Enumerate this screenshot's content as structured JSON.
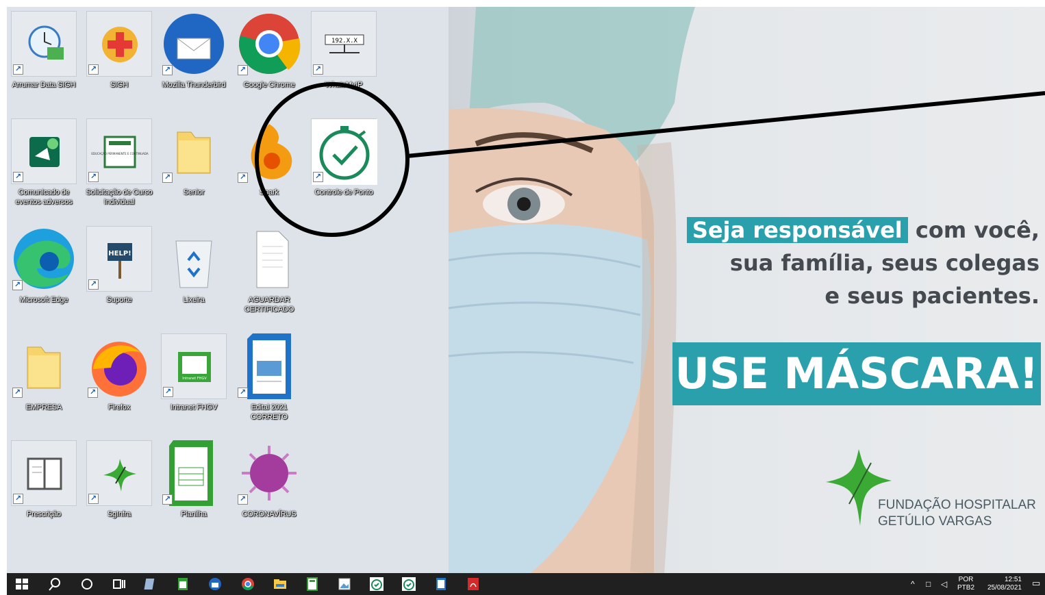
{
  "desktop_icons": [
    {
      "label": "Arrumar Data SIGH",
      "icon": "clock-calendar-icon"
    },
    {
      "label": "SIGH",
      "icon": "medical-cross-icon"
    },
    {
      "label": "Mozilla Thunderbird",
      "icon": "thunderbird-icon"
    },
    {
      "label": "Google Chrome",
      "icon": "chrome-icon"
    },
    {
      "label": "WhatsMyIP",
      "icon": "network-ip-icon",
      "badge": "192.X.X"
    },
    {
      "label": "Comunicado de eventos adversos",
      "icon": "megaphone-icon"
    },
    {
      "label": "Solicitação de Curso Individual",
      "icon": "education-certificate-icon",
      "badge": "EDUCAÇÃO PERMANENTE E CONTINUADA"
    },
    {
      "label": "Senior",
      "icon": "folder-icon"
    },
    {
      "label": "Spark",
      "icon": "spark-flame-icon"
    },
    {
      "label": "Controle de Ponto",
      "icon": "stopwatch-check-icon"
    },
    {
      "label": "Microsoft Edge",
      "icon": "edge-icon"
    },
    {
      "label": "Suporte",
      "icon": "help-sign-icon",
      "badge": "HELP!"
    },
    {
      "label": "Lixeira",
      "icon": "recycle-bin-icon"
    },
    {
      "label": "AGUARDAR CERTIFICADO",
      "icon": "document-icon"
    },
    {
      "label": "EMPRESA",
      "icon": "folder-icon"
    },
    {
      "label": "Firefox",
      "icon": "firefox-icon"
    },
    {
      "label": "Intranet FHGV",
      "icon": "intranet-icon",
      "badge": "Intranet FHGV"
    },
    {
      "label": "Edital 2021 CORRETO",
      "icon": "writer-document-icon"
    },
    {
      "label": "Prescrição",
      "icon": "book-icon"
    },
    {
      "label": "SgInfra",
      "icon": "fhgv-cross-icon"
    },
    {
      "label": "Planilha",
      "icon": "calc-spreadsheet-icon"
    },
    {
      "label": "CORONAVÍRUS",
      "icon": "virus-icon"
    }
  ],
  "wallpaper": {
    "line1_highlight": "Seja responsável",
    "line1_rest": "com você,",
    "line2": "sua família, seus colegas",
    "line3": "e seus pacientes.",
    "banner": "USE MÁSCARA!",
    "org_line1": "FUNDAÇÃO HOSPITALAR",
    "org_line2": "GETÚLIO VARGAS",
    "accent_color": "#2aa0ad",
    "brand_green": "#3aaa35"
  },
  "taskbar": {
    "items": [
      "start-icon",
      "search-icon",
      "cortana-icon",
      "task-view-icon",
      "libreoffice-icon",
      "spreadsheet-icon",
      "thunderbird-icon",
      "chrome-icon",
      "file-explorer-icon",
      "calculator-icon",
      "image-viewer-icon",
      "stopwatch-icon",
      "stopwatch-icon",
      "document-icon",
      "pdf-icon"
    ],
    "language": "POR",
    "keyboard": "PTB2",
    "time": "12:51",
    "date": "25/08/2021"
  }
}
